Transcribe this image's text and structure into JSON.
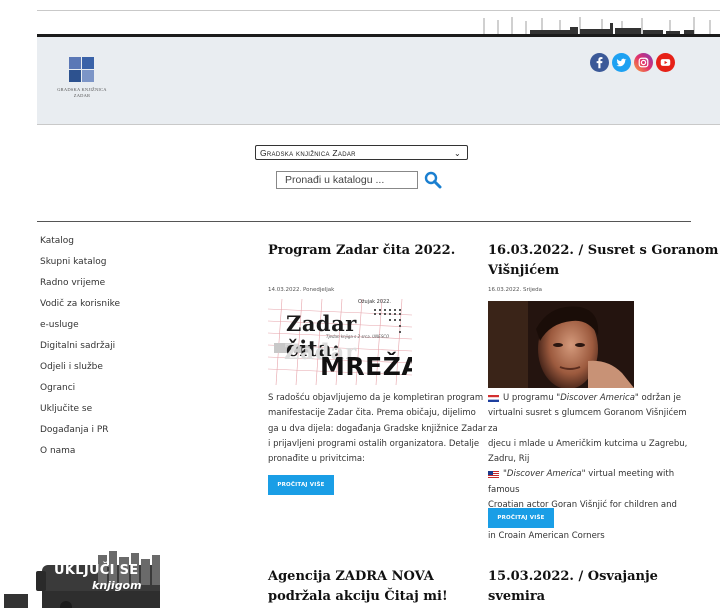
{
  "header": {
    "logo_text_1": "GRADSKA KNJIŽNICA",
    "logo_text_2": "ZADAR",
    "social": [
      "facebook-icon",
      "twitter-icon",
      "instagram-icon",
      "youtube-icon"
    ]
  },
  "search": {
    "library_select": "Gradska knjižnica Zadar",
    "placeholder": "Pronađi u katalogu ..."
  },
  "nav": {
    "items": [
      "Katalog",
      "Skupni katalog",
      "Radno vrijeme",
      "Vodič za korisnike",
      "e-usluge",
      "Digitalni sadržaji",
      "Odjeli i službe",
      "Ogranci",
      "Uključite se",
      "Događanja i PR",
      "O nama"
    ]
  },
  "articles": [
    {
      "title": "Program Zadar čita 2022.",
      "date": "14.03.2022. Ponedjeljak",
      "poster_month": "Ožujak 2022.",
      "poster_title": "Zadar čita:",
      "poster_word": "MREŽA",
      "poster_ghost": "Zadar",
      "poster_small": "Tjedan knjiga s 2 srca. UNESCO",
      "body": [
        "S radošću objavljujemo da je kompletiran program",
        "manifestacije Zadar čita. Prema običaju, dijelimo",
        "ga u dva dijela: događanja Gradske knjižnice Zadar",
        "i prijavljeni programi ostalih organizatora. Detalje",
        "pronađite u privitcima:"
      ],
      "read_more": "PROČITAJ VIŠE"
    },
    {
      "title_1": "16.03.2022. / Susret s Goranom",
      "title_2": "Višnjićem",
      "date": "16.03.2022. Srijeda",
      "hr_line_1_pre": "U programu ",
      "hr_line_1_em": "\"Discover America\"",
      "hr_line_1_post": " održan je",
      "hr_lines": [
        "virtualni susret s glumcem Goranom Višnjićem za",
        "djecu i mlade u Američkim kutcima u Zagrebu,",
        "Zadru, Rij"
      ],
      "en_line_1_em": "\"Discover America\"",
      "en_line_1_post": " virtual meeting with famous",
      "en_lines": [
        "Croatian actor Goran Višnjić for children and youth",
        "in Croain American Corners"
      ],
      "read_more": "PROČITAJ VIŠE"
    },
    {
      "title_1": "Agencija ZADRA NOVA",
      "title_2": "podržala akciju Čitaj mi!"
    },
    {
      "title_1": "15.03.2022. / Osvajanje",
      "title_2": "svemira"
    }
  ],
  "banner": {
    "line1": "UKLJUČI SE",
    "line2": "knjigom"
  },
  "colors": {
    "accent": "#1a9ee6",
    "header_bg": "#e9edf1",
    "logo_blue": "#3a62a8"
  }
}
